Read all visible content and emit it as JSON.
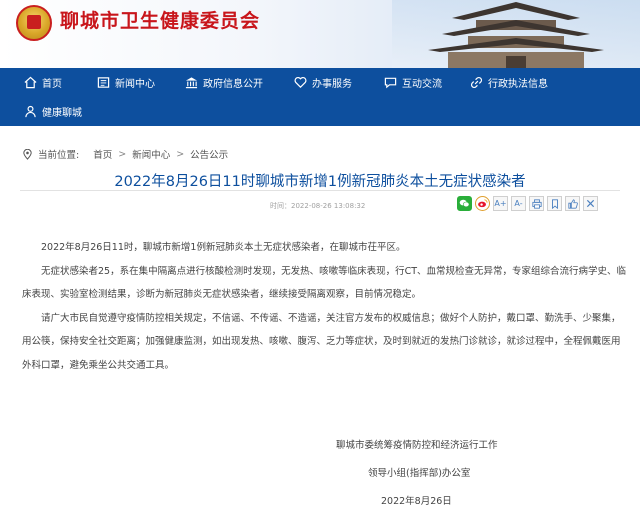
{
  "header": {
    "site_title": "聊城市卫生健康委员会"
  },
  "nav": {
    "items": [
      {
        "label": "首页",
        "icon": "home-icon"
      },
      {
        "label": "新闻中心",
        "icon": "news-icon"
      },
      {
        "label": "政府信息公开",
        "icon": "building-icon"
      },
      {
        "label": "办事服务",
        "icon": "heart-icon"
      },
      {
        "label": "互动交流",
        "icon": "chat-icon"
      },
      {
        "label": "行政执法信息",
        "icon": "link-icon"
      },
      {
        "label": "健康聊城",
        "icon": "person-icon"
      }
    ]
  },
  "breadcrumb": {
    "prefix": "当前位置:",
    "items": [
      "首页",
      "新闻中心",
      "公告公示"
    ],
    "separator": ">"
  },
  "article": {
    "title": "2022年8月26日11时聊城市新增1例新冠肺炎本土无症状感染者",
    "timestamp": "时间：2022-08-26 13:08:32",
    "paragraphs": [
      "2022年8月26日11时，聊城市新增1例新冠肺炎本土无症状感染者，在聊城市茌平区。",
      "无症状感染者25，系在集中隔离点进行核酸检测时发现，无发热、咳嗽等临床表现，行CT、血常规检查无异常，专家组综合流行病学史、临床表现、实验室检测结果，诊断为新冠肺炎无症状感染者，继续接受隔离观察，目前情况稳定。",
      "请广大市民自觉遵守疫情防控相关规定，不信谣、不传谣、不造谣，关注官方发布的权威信息；做好个人防护，戴口罩、勤洗手、少聚集，用公筷，保持安全社交距离；加强健康监测，如出现发热、咳嗽、腹泻、乏力等症状，及时到就近的发热门诊就诊，就诊过程中，全程佩戴医用外科口罩，避免乘坐公共交通工具。"
    ],
    "signature": {
      "line1": "聊城市委统筹疫情防控和经济运行工作",
      "line2": "领导小组(指挥部)办公室",
      "date": "2022年8月26日"
    }
  },
  "tools": {
    "font_increase": "A+",
    "font_decrease": "A-"
  },
  "colors": {
    "brand_red": "#c8151b",
    "nav_blue": "#0d4f9e"
  }
}
